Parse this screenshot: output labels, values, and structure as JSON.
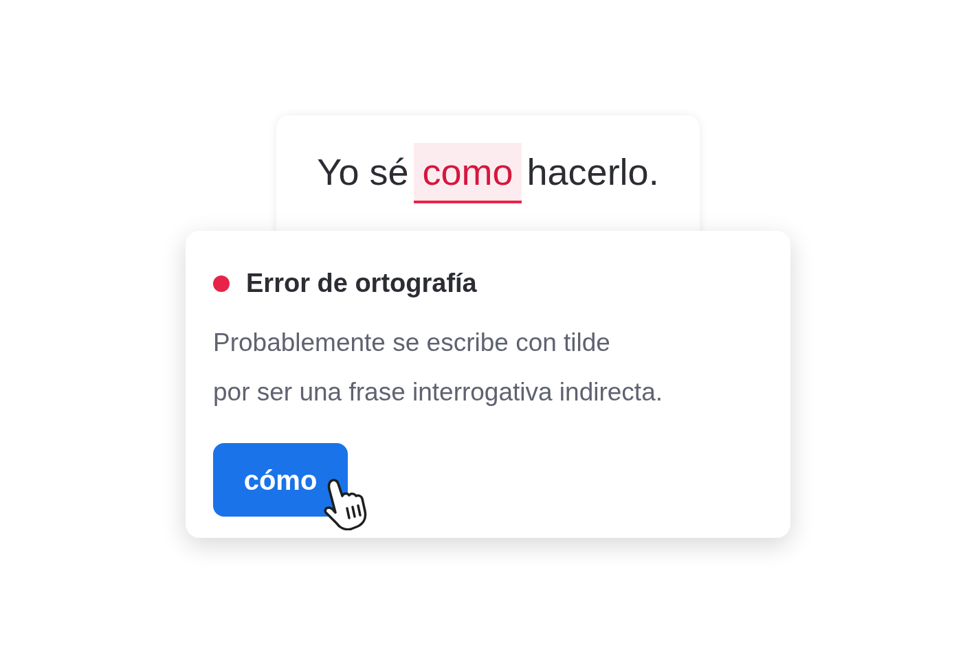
{
  "sentence": {
    "parts": [
      {
        "kind": "plain",
        "text": "Yo sé"
      },
      {
        "kind": "error",
        "text": "como"
      },
      {
        "kind": "plain",
        "text": "hacerlo."
      }
    ]
  },
  "popup": {
    "title": "Error de ortografía",
    "color": "#e8234a",
    "description_lines": [
      "Probablemente se escribe con tilde",
      "por ser una frase interrogativa indirecta."
    ],
    "suggestion": "cómo"
  }
}
